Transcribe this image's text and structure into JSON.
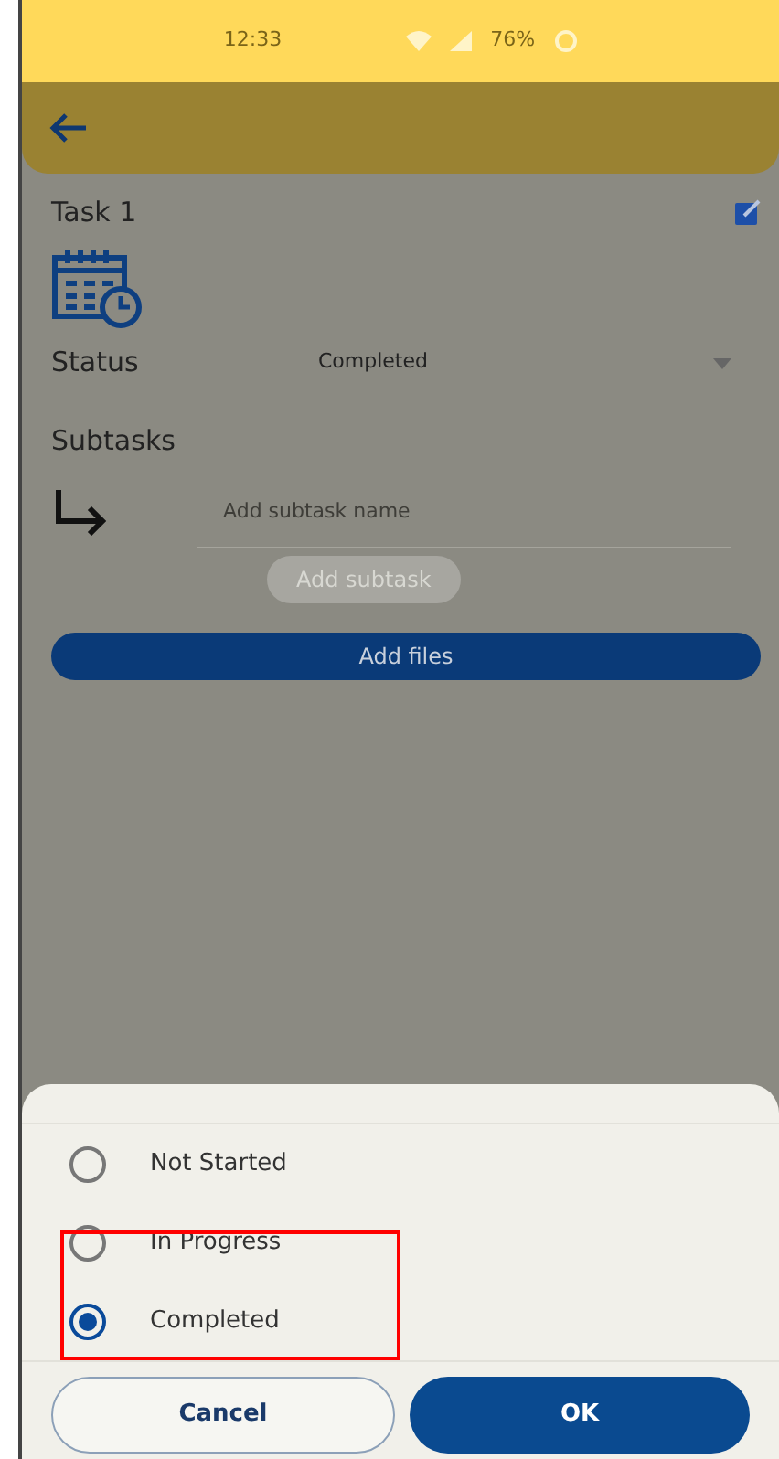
{
  "status_bar": {
    "time": "12:33",
    "battery": "76%"
  },
  "task": {
    "title": "Task 1"
  },
  "status": {
    "label": "Status",
    "value": "Completed"
  },
  "subtasks": {
    "label": "Subtasks",
    "placeholder": "Add subtask name",
    "add_button": "Add subtask"
  },
  "add_files_button": "Add files",
  "sheet": {
    "options": [
      {
        "label": "Not Started",
        "selected": false
      },
      {
        "label": "In Progress",
        "selected": false
      },
      {
        "label": "Completed",
        "selected": true
      }
    ],
    "cancel_button": "Cancel",
    "ok_button": "OK"
  },
  "highlight_box": true
}
